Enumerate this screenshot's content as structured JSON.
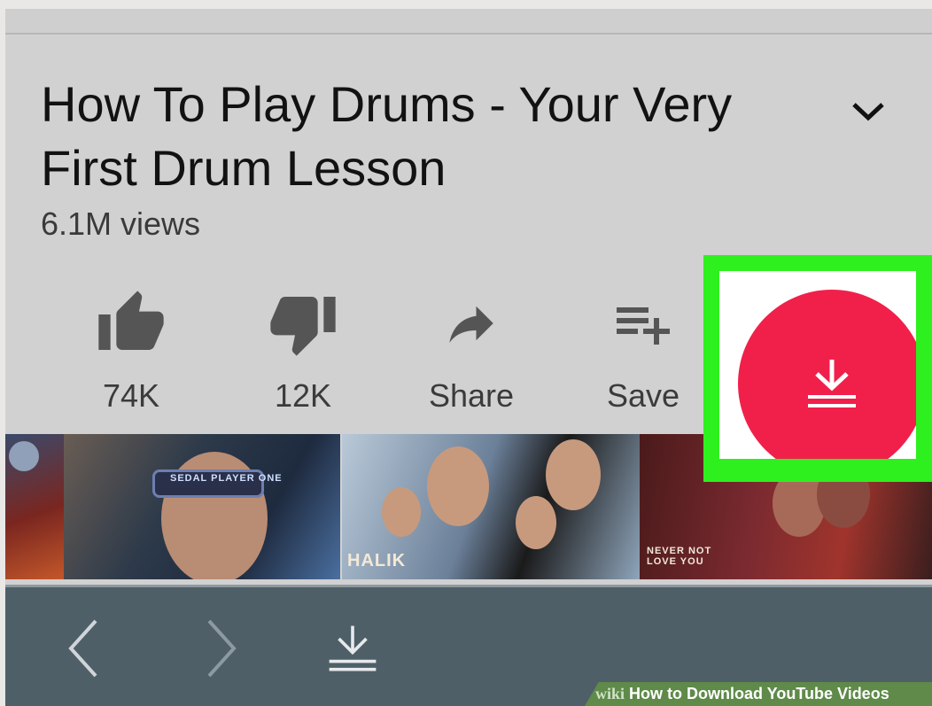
{
  "video": {
    "title": "How To Play Drums - Your Very First Drum Lesson",
    "views": "6.1M views"
  },
  "actions": [
    {
      "icon": "thumbs-up-icon",
      "label": "74K"
    },
    {
      "icon": "thumbs-down-icon",
      "label": "12K"
    },
    {
      "icon": "share-icon",
      "label": "Share"
    },
    {
      "icon": "playlist-add-icon",
      "label": "Save"
    }
  ],
  "download_fab": {
    "icon": "download-icon",
    "color": "#f1204a",
    "highlight_color": "#2ef01f"
  },
  "thumbnails": [
    {
      "text": ""
    },
    {
      "text": "SEDAL PLAYER ONE"
    },
    {
      "text": "HALIK"
    },
    {
      "text": "NEVER NOT LOVE YOU"
    }
  ],
  "bottom_bar": {
    "back_icon": "chevron-left-icon",
    "forward_icon": "chevron-right-icon",
    "download_icon": "download-icon"
  },
  "watermark": {
    "brand": "wiki",
    "text": "How to Download YouTube Videos"
  }
}
